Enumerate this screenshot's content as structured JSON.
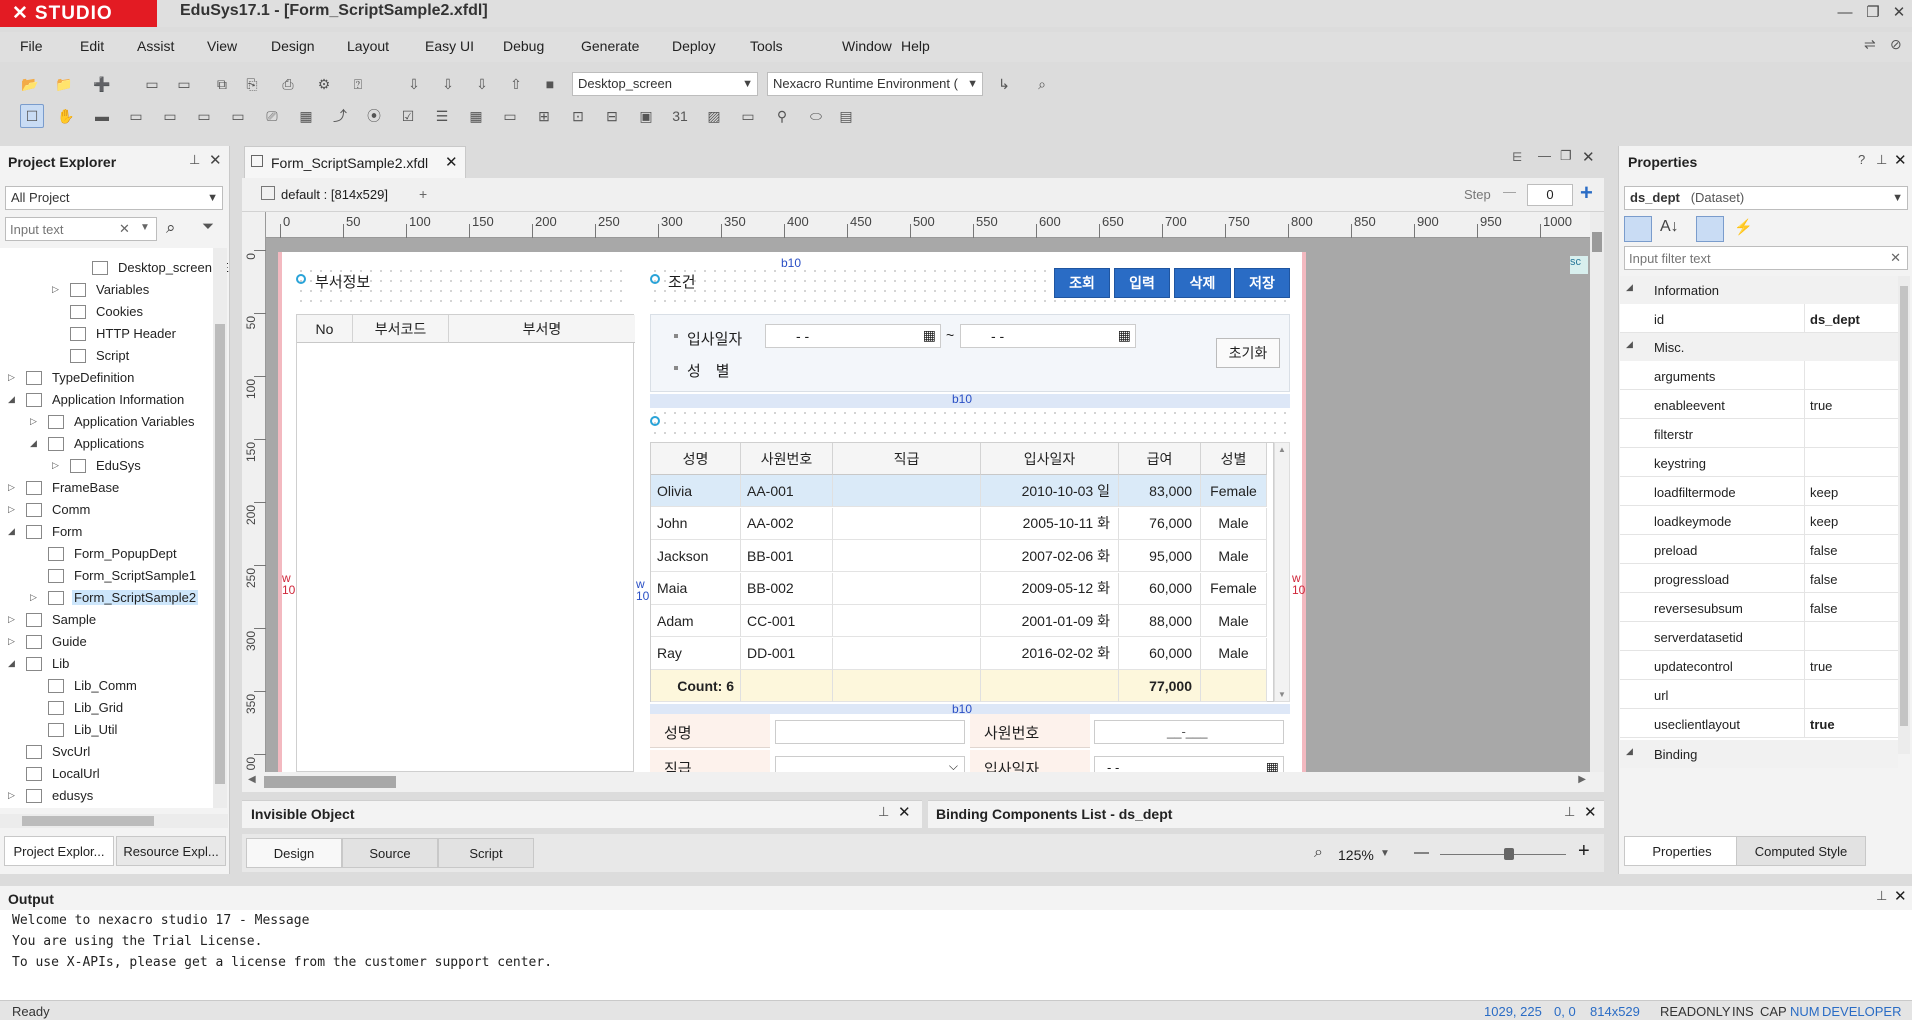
{
  "app": {
    "logo": "STUDIO",
    "title": "EduSys17.1 - [Form_ScriptSample2.xfdl]",
    "win_min": "—",
    "win_max": "❐",
    "win_close": "✕"
  },
  "menu": [
    "File",
    "Edit",
    "Assist",
    "View",
    "Design",
    "Layout",
    "Easy UI",
    "Debug",
    "Generate",
    "Deploy",
    "Tools",
    "Window",
    "Help"
  ],
  "toolbar": {
    "screen_combo": "Desktop_screen",
    "runtime_combo": "Nexacro Runtime Environment (⁠"
  },
  "project_explorer": {
    "title": "Project Explorer",
    "filter_combo": "All Project",
    "search_placeholder": "Input text",
    "items": [
      {
        "label": "Desktop_screen \"E",
        "indent": 3,
        "tw": ""
      },
      {
        "label": "Variables",
        "indent": 2,
        "tw": "▷"
      },
      {
        "label": "Cookies",
        "indent": 2,
        "tw": ""
      },
      {
        "label": "HTTP Header",
        "indent": 2,
        "tw": ""
      },
      {
        "label": "Script",
        "indent": 2,
        "tw": ""
      },
      {
        "label": "TypeDefinition",
        "indent": 0,
        "tw": "▷"
      },
      {
        "label": "Application Information",
        "indent": 0,
        "tw": "◢"
      },
      {
        "label": "Application Variables",
        "indent": 1,
        "tw": "▷"
      },
      {
        "label": "Applications",
        "indent": 1,
        "tw": "◢"
      },
      {
        "label": "EduSys",
        "indent": 2,
        "tw": "▷"
      },
      {
        "label": "FrameBase",
        "indent": 0,
        "tw": "▷"
      },
      {
        "label": "Comm",
        "indent": 0,
        "tw": "▷"
      },
      {
        "label": "Form",
        "indent": 0,
        "tw": "◢"
      },
      {
        "label": "Form_PopupDept",
        "indent": 1,
        "tw": ""
      },
      {
        "label": "Form_ScriptSample1",
        "indent": 1,
        "tw": ""
      },
      {
        "label": "Form_ScriptSample2",
        "indent": 1,
        "tw": "▷",
        "selected": true
      },
      {
        "label": "Sample",
        "indent": 0,
        "tw": "▷"
      },
      {
        "label": "Guide",
        "indent": 0,
        "tw": "▷"
      },
      {
        "label": "Lib",
        "indent": 0,
        "tw": "◢"
      },
      {
        "label": "Lib_Comm",
        "indent": 1,
        "tw": ""
      },
      {
        "label": "Lib_Grid",
        "indent": 1,
        "tw": ""
      },
      {
        "label": "Lib_Util",
        "indent": 1,
        "tw": ""
      },
      {
        "label": "SvcUrl",
        "indent": 0,
        "tw": ""
      },
      {
        "label": "LocalUrl",
        "indent": 0,
        "tw": ""
      },
      {
        "label": "edusys",
        "indent": 0,
        "tw": "▷"
      }
    ],
    "tabs": [
      "Project Explor...",
      "Resource Expl..."
    ]
  },
  "editor": {
    "tab_title": "Form_ScriptSample2.xfdl",
    "layout_label": "default : [814x529]",
    "add_label": "+",
    "step_label": "Step",
    "step_value": "0",
    "ruler_h": [
      "0",
      "50",
      "100",
      "150",
      "200",
      "250",
      "300",
      "350",
      "400",
      "450",
      "500",
      "550",
      "600",
      "650",
      "700",
      "750",
      "800",
      "850",
      "900",
      "950",
      "1000"
    ],
    "ruler_v": [
      "0",
      "50",
      "100",
      "150",
      "200",
      "250",
      "300",
      "350",
      "00"
    ],
    "markers": {
      "b10": "b10",
      "w10": "w\n10",
      "sc": "sc"
    },
    "dept": {
      "title": "부서정보",
      "headers": [
        "No",
        "부서코드",
        "부서명"
      ]
    },
    "cond": {
      "title": "조건",
      "buttons": [
        "조회",
        "입력",
        "삭제",
        "저장"
      ],
      "date_label": "입사일자",
      "date_from": "- -",
      "date_to": "- -",
      "tilde": "~",
      "gender_label": "성　별",
      "reset": "초기화"
    },
    "grid": {
      "headers": [
        "성명",
        "사원번호",
        "직급",
        "입사일자",
        "급여",
        "성별"
      ],
      "rows": [
        [
          "Olivia",
          "AA-001",
          "",
          "2010-10-03 일",
          "83,000",
          "Female"
        ],
        [
          "John",
          "AA-002",
          "",
          "2005-10-11 화",
          "76,000",
          "Male"
        ],
        [
          "Jackson",
          "BB-001",
          "",
          "2007-02-06 화",
          "95,000",
          "Male"
        ],
        [
          "Maia",
          "BB-002",
          "",
          "2009-05-12 화",
          "60,000",
          "Female"
        ],
        [
          "Adam",
          "CC-001",
          "",
          "2001-01-09 화",
          "88,000",
          "Male"
        ],
        [
          "Ray",
          "DD-001",
          "",
          "2016-02-02 화",
          "60,000",
          "Male"
        ]
      ],
      "footer": {
        "count": "Count: 6",
        "salary": "77,000"
      }
    },
    "detail": {
      "name": "성명",
      "empno": "사원번호",
      "empno_mask": "__-___",
      "rank": "직급",
      "hiredate": "입사일자",
      "hiredate_mask": "- -"
    },
    "bottom_tabs": [
      "Design",
      "Source",
      "Script"
    ],
    "zoom": "125%"
  },
  "invisible_panel": {
    "title": "Invisible Object"
  },
  "binding_panel": {
    "title": "Binding Components List - ds_dept"
  },
  "properties": {
    "title": "Properties",
    "object": "ds_dept",
    "object_type": "(Dataset)",
    "filter_placeholder": "Input filter text",
    "group_info": "Information",
    "group_misc": "Misc.",
    "group_binding": "Binding",
    "rows": [
      {
        "name": "id",
        "value": "ds_dept",
        "bold": true,
        "group": "info"
      },
      {
        "name": "arguments",
        "value": ""
      },
      {
        "name": "enableevent",
        "value": "true"
      },
      {
        "name": "filterstr",
        "value": ""
      },
      {
        "name": "keystring",
        "value": ""
      },
      {
        "name": "loadfiltermode",
        "value": "keep"
      },
      {
        "name": "loadkeymode",
        "value": "keep"
      },
      {
        "name": "preload",
        "value": "false"
      },
      {
        "name": "progressload",
        "value": "false"
      },
      {
        "name": "reversesubsum",
        "value": "false"
      },
      {
        "name": "serverdatasetid",
        "value": ""
      },
      {
        "name": "updatecontrol",
        "value": "true"
      },
      {
        "name": "url",
        "value": ""
      },
      {
        "name": "useclientlayout",
        "value": "true",
        "bold": true
      }
    ],
    "tabs": [
      "Properties",
      "Computed Style"
    ]
  },
  "output": {
    "title": "Output",
    "lines": [
      "Welcome to nexacro studio 17 - Message",
      "You are using the Trial License.",
      "To use X-APIs, please get a license from the customer support center."
    ]
  },
  "status": {
    "left": "Ready",
    "right": [
      "1029, 225",
      "0, 0",
      "814x529",
      "READONLY",
      "INS",
      "CAP",
      "NUM",
      "DEVELOPER"
    ]
  }
}
